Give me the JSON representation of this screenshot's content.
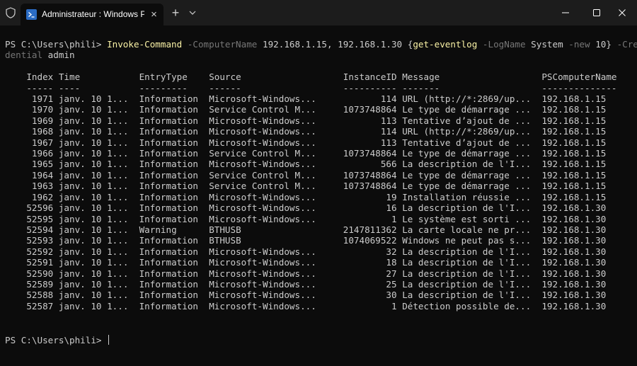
{
  "titlebar": {
    "tab_title": "Administrateur : Windows PowerShell",
    "close_tab_glyph": "×",
    "new_tab_glyph": "+",
    "icons": [
      "shield-icon",
      "powershell-icon",
      "close-icon",
      "plus-icon",
      "chevron-down-icon",
      "minimize-icon",
      "maximize-icon",
      "window-close-icon"
    ]
  },
  "command": {
    "prompt": "PS C:\\Users\\phili> ",
    "cmdlet": "Invoke-Command",
    "param_computername": "-ComputerName",
    "computers": "192.168.1.15, 192.168.1.30",
    "block_open": "{",
    "inner_cmdlet": "get-eventlog",
    "param_logname": "-LogName",
    "logname": "System",
    "param_new": "-new",
    "new_value": "10",
    "block_close": "}",
    "param_credential_part1": "-Cre",
    "param_credential_part2": "dential",
    "credential": "admin"
  },
  "table": {
    "columns": [
      "Index",
      "Time",
      "EntryType",
      "Source",
      "InstanceID",
      "Message",
      "PSComputerName"
    ],
    "separators": [
      "-----",
      "----",
      "---------",
      "------",
      "----------",
      "-------",
      "--------------"
    ],
    "rows": [
      [
        "1971",
        "janv. 10 1...",
        "Information",
        "Microsoft-Windows...",
        "114",
        "URL (http://*:2869/up...",
        "192.168.1.15"
      ],
      [
        "1970",
        "janv. 10 1...",
        "Information",
        "Service Control M...",
        "1073748864",
        "Le type de démarrage ...",
        "192.168.1.15"
      ],
      [
        "1969",
        "janv. 10 1...",
        "Information",
        "Microsoft-Windows...",
        "113",
        "Tentative d’ajout de ...",
        "192.168.1.15"
      ],
      [
        "1968",
        "janv. 10 1...",
        "Information",
        "Microsoft-Windows...",
        "114",
        "URL (http://*:2869/up...",
        "192.168.1.15"
      ],
      [
        "1967",
        "janv. 10 1...",
        "Information",
        "Microsoft-Windows...",
        "113",
        "Tentative d’ajout de ...",
        "192.168.1.15"
      ],
      [
        "1966",
        "janv. 10 1...",
        "Information",
        "Service Control M...",
        "1073748864",
        "Le type de démarrage ...",
        "192.168.1.15"
      ],
      [
        "1965",
        "janv. 10 1...",
        "Information",
        "Microsoft-Windows...",
        "566",
        "La description de l'I...",
        "192.168.1.15"
      ],
      [
        "1964",
        "janv. 10 1...",
        "Information",
        "Service Control M...",
        "1073748864",
        "Le type de démarrage ...",
        "192.168.1.15"
      ],
      [
        "1963",
        "janv. 10 1...",
        "Information",
        "Service Control M...",
        "1073748864",
        "Le type de démarrage ...",
        "192.168.1.15"
      ],
      [
        "1962",
        "janv. 10 1...",
        "Information",
        "Microsoft-Windows...",
        "19",
        "Installation réussie ...",
        "192.168.1.15"
      ],
      [
        "52596",
        "janv. 10 1...",
        "Information",
        "Microsoft-Windows...",
        "16",
        "La description de l'I...",
        "192.168.1.30"
      ],
      [
        "52595",
        "janv. 10 1...",
        "Information",
        "Microsoft-Windows...",
        "1",
        "Le système est sorti ...",
        "192.168.1.30"
      ],
      [
        "52594",
        "janv. 10 1...",
        "Warning",
        "BTHUSB",
        "2147811362",
        "La carte locale ne pr...",
        "192.168.1.30"
      ],
      [
        "52593",
        "janv. 10 1...",
        "Information",
        "BTHUSB",
        "1074069522",
        "Windows ne peut pas s...",
        "192.168.1.30"
      ],
      [
        "52592",
        "janv. 10 1...",
        "Information",
        "Microsoft-Windows...",
        "32",
        "La description de l'I...",
        "192.168.1.30"
      ],
      [
        "52591",
        "janv. 10 1...",
        "Information",
        "Microsoft-Windows...",
        "18",
        "La description de l'I...",
        "192.168.1.30"
      ],
      [
        "52590",
        "janv. 10 1...",
        "Information",
        "Microsoft-Windows...",
        "27",
        "La description de l'I...",
        "192.168.1.30"
      ],
      [
        "52589",
        "janv. 10 1...",
        "Information",
        "Microsoft-Windows...",
        "25",
        "La description de l'I...",
        "192.168.1.30"
      ],
      [
        "52588",
        "janv. 10 1...",
        "Information",
        "Microsoft-Windows...",
        "30",
        "La description de l'I...",
        "192.168.1.30"
      ],
      [
        "52587",
        "janv. 10 1...",
        "Information",
        "Microsoft-Windows...",
        "1",
        "Détection possible de...",
        "192.168.1.30"
      ]
    ]
  },
  "final_prompt": "PS C:\\Users\\phili> ",
  "colors": {
    "background": "#0c0c0c",
    "titlebar": "#1c1c1c",
    "text": "#cccccc",
    "cmdlet": "#f9f1a5",
    "parameter": "#767676"
  }
}
